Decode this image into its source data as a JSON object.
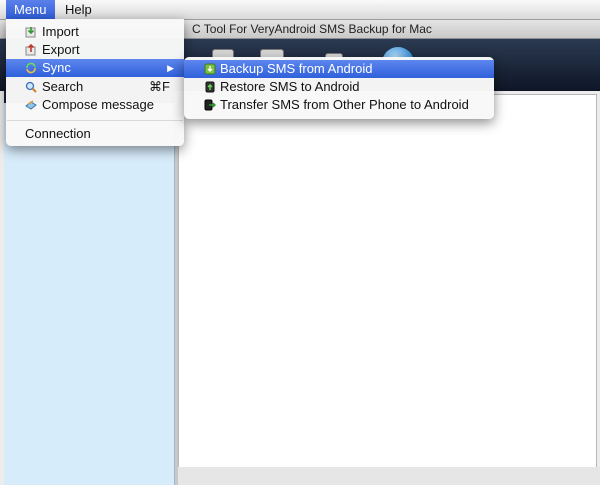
{
  "menubar": {
    "menu": "Menu",
    "help": "Help"
  },
  "window": {
    "title": "C Tool For VeryAndroid SMS Backup for Mac"
  },
  "menu": {
    "import": "Import",
    "export": "Export",
    "sync": "Sync",
    "search": "Search",
    "search_shortcut": "⌘F",
    "compose": "Compose message",
    "connection": "Connection"
  },
  "sync_submenu": {
    "backup": "Backup SMS from Android",
    "restore": "Restore SMS to Android",
    "transfer": "Transfer SMS from Other Phone to Android"
  }
}
